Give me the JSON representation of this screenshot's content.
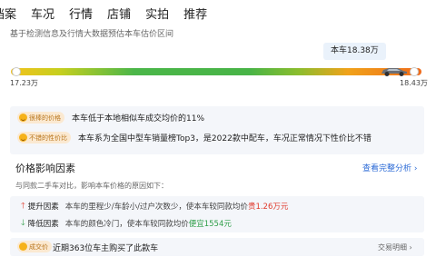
{
  "nav": {
    "tabs": [
      {
        "label": "档案"
      },
      {
        "label": "车况"
      },
      {
        "label": "行情"
      },
      {
        "label": "店铺"
      },
      {
        "label": "实拍"
      },
      {
        "label": "推荐"
      }
    ]
  },
  "valuation": {
    "subtitle": "基于检测信息及行情大数据预估本车估价区间",
    "car_price_label": "本车18.38万",
    "range_low": "17.23万",
    "range_high": "18.43万"
  },
  "highlights": [
    {
      "tag": "很棒的价格",
      "text": "本车低于本地相似车成交均价的11%"
    },
    {
      "tag": "不错的性价比",
      "text": "本车系为全国中型车销量榜Top3，是2022款中配车，车况正常情况下性价比不错"
    }
  ],
  "factors": {
    "title": "价格影响因素",
    "link": "查看完整分析 ›",
    "description": "与同款二手车对比，影响本车价格的原因如下：",
    "up": {
      "name": "提升因素",
      "text": "本车的里程少/车龄小/过户次数少，使本车较同款均价",
      "value": "贵1.26万元"
    },
    "down": {
      "name": "降低因素",
      "text": "本车的颜色冷门，使本车较同款均价",
      "value": "便宜1554元"
    }
  },
  "deals": {
    "tag": "成交价",
    "text": "近期363位车主购买了此款车",
    "link": "交易明细 ›"
  },
  "colors": {
    "accent_blue": "#2b6ad6",
    "price_up": "#e03b2d",
    "price_down": "#2e9e48",
    "tag_orange": "#b8741a"
  }
}
